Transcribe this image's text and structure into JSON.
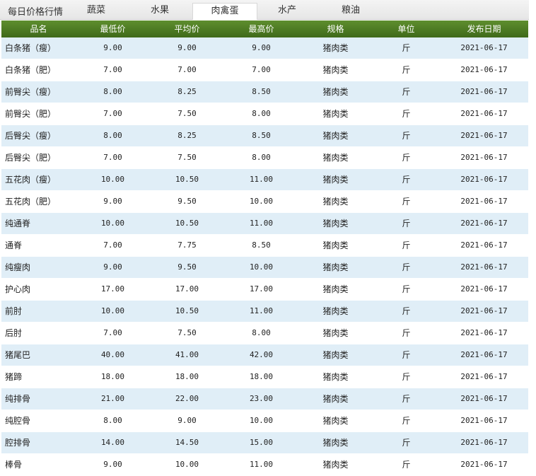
{
  "tabs": {
    "title": "每日价格行情",
    "items": [
      {
        "label": "蔬菜"
      },
      {
        "label": "水果"
      },
      {
        "label": "肉禽蛋"
      },
      {
        "label": "水产"
      },
      {
        "label": "粮油"
      }
    ],
    "active_index": 2
  },
  "table": {
    "headers": {
      "name": "品名",
      "min": "最低价",
      "avg": "平均价",
      "max": "最高价",
      "spec": "规格",
      "unit": "单位",
      "date": "发布日期"
    },
    "rows": [
      {
        "name": "白条猪（瘦）",
        "min": "9.00",
        "avg": "9.00",
        "max": "9.00",
        "spec": "猪肉类",
        "unit": "斤",
        "date": "2021-06-17"
      },
      {
        "name": "白条猪（肥）",
        "min": "7.00",
        "avg": "7.00",
        "max": "7.00",
        "spec": "猪肉类",
        "unit": "斤",
        "date": "2021-06-17"
      },
      {
        "name": "前臀尖（瘦）",
        "min": "8.00",
        "avg": "8.25",
        "max": "8.50",
        "spec": "猪肉类",
        "unit": "斤",
        "date": "2021-06-17"
      },
      {
        "name": "前臀尖（肥）",
        "min": "7.00",
        "avg": "7.50",
        "max": "8.00",
        "spec": "猪肉类",
        "unit": "斤",
        "date": "2021-06-17"
      },
      {
        "name": "后臀尖（瘦）",
        "min": "8.00",
        "avg": "8.25",
        "max": "8.50",
        "spec": "猪肉类",
        "unit": "斤",
        "date": "2021-06-17"
      },
      {
        "name": "后臀尖（肥）",
        "min": "7.00",
        "avg": "7.50",
        "max": "8.00",
        "spec": "猪肉类",
        "unit": "斤",
        "date": "2021-06-17"
      },
      {
        "name": "五花肉（瘦）",
        "min": "10.00",
        "avg": "10.50",
        "max": "11.00",
        "spec": "猪肉类",
        "unit": "斤",
        "date": "2021-06-17"
      },
      {
        "name": "五花肉（肥）",
        "min": "9.00",
        "avg": "9.50",
        "max": "10.00",
        "spec": "猪肉类",
        "unit": "斤",
        "date": "2021-06-17"
      },
      {
        "name": "纯通脊",
        "min": "10.00",
        "avg": "10.50",
        "max": "11.00",
        "spec": "猪肉类",
        "unit": "斤",
        "date": "2021-06-17"
      },
      {
        "name": "通脊",
        "min": "7.00",
        "avg": "7.75",
        "max": "8.50",
        "spec": "猪肉类",
        "unit": "斤",
        "date": "2021-06-17"
      },
      {
        "name": "纯瘦肉",
        "min": "9.00",
        "avg": "9.50",
        "max": "10.00",
        "spec": "猪肉类",
        "unit": "斤",
        "date": "2021-06-17"
      },
      {
        "name": "护心肉",
        "min": "17.00",
        "avg": "17.00",
        "max": "17.00",
        "spec": "猪肉类",
        "unit": "斤",
        "date": "2021-06-17"
      },
      {
        "name": "前肘",
        "min": "10.00",
        "avg": "10.50",
        "max": "11.00",
        "spec": "猪肉类",
        "unit": "斤",
        "date": "2021-06-17"
      },
      {
        "name": "后肘",
        "min": "7.00",
        "avg": "7.50",
        "max": "8.00",
        "spec": "猪肉类",
        "unit": "斤",
        "date": "2021-06-17"
      },
      {
        "name": "猪尾巴",
        "min": "40.00",
        "avg": "41.00",
        "max": "42.00",
        "spec": "猪肉类",
        "unit": "斤",
        "date": "2021-06-17"
      },
      {
        "name": "猪蹄",
        "min": "18.00",
        "avg": "18.00",
        "max": "18.00",
        "spec": "猪肉类",
        "unit": "斤",
        "date": "2021-06-17"
      },
      {
        "name": "纯排骨",
        "min": "21.00",
        "avg": "22.00",
        "max": "23.00",
        "spec": "猪肉类",
        "unit": "斤",
        "date": "2021-06-17"
      },
      {
        "name": "纯腔骨",
        "min": "8.00",
        "avg": "9.00",
        "max": "10.00",
        "spec": "猪肉类",
        "unit": "斤",
        "date": "2021-06-17"
      },
      {
        "name": "腔排骨",
        "min": "14.00",
        "avg": "14.50",
        "max": "15.00",
        "spec": "猪肉类",
        "unit": "斤",
        "date": "2021-06-17"
      },
      {
        "name": "棒骨",
        "min": "9.00",
        "avg": "10.00",
        "max": "11.00",
        "spec": "猪肉类",
        "unit": "斤",
        "date": "2021-06-17"
      }
    ]
  },
  "colors": {
    "header_bg": "#4a7a22",
    "row_alt_bg": "#e0eef7"
  }
}
